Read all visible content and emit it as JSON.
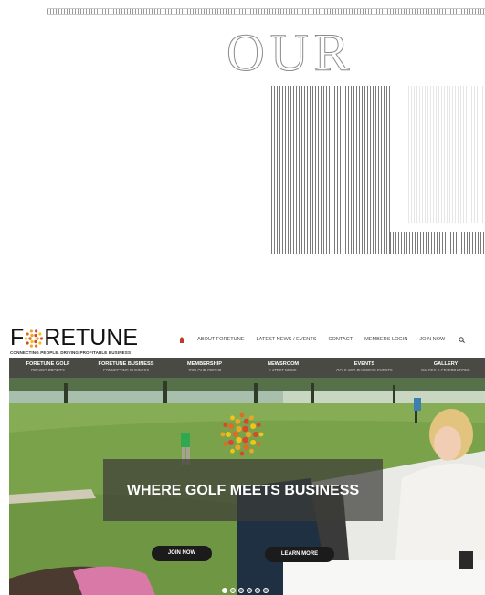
{
  "ghost_heading": "OUR",
  "logo": {
    "word_pre": "F",
    "word_post": "RETUNE",
    "tagline": "CONNECTING PEOPLE. DRIVING PROFITABLE BUSINESS"
  },
  "top_nav": {
    "items": [
      "ABOUT FORETUNE",
      "LATEST NEWS / EVENTS",
      "CONTACT",
      "MEMBERS LOGIN",
      "JOIN NOW"
    ]
  },
  "categories": [
    {
      "title": "FORETUNE GOLF",
      "subtitle": "DRIVING PROFITS"
    },
    {
      "title": "FORETUNE BUSINESS",
      "subtitle": "CONNECTING BUSINESS"
    },
    {
      "title": "MEMBERSHIP",
      "subtitle": "JOIN OUR GROUP"
    },
    {
      "title": "NEWSROOM",
      "subtitle": "LATEST NEWS"
    },
    {
      "title": "EVENTS",
      "subtitle": "GOLF AND BUSINESS EVENTS"
    },
    {
      "title": "GALLERY",
      "subtitle": "IMAGES & CELEBRATIONS"
    }
  ],
  "hero": {
    "headline": "WHERE GOLF MEETS BUSINESS",
    "join_label": "JOIN NOW",
    "learn_label": "LEARN MORE",
    "slides": 6,
    "active_slide": 1
  },
  "colors": {
    "accent_red": "#c0392b",
    "category_bar": "#4a4a44",
    "logo_dots": [
      "#e8a825",
      "#d9482b",
      "#f0c419",
      "#e06b24"
    ]
  }
}
